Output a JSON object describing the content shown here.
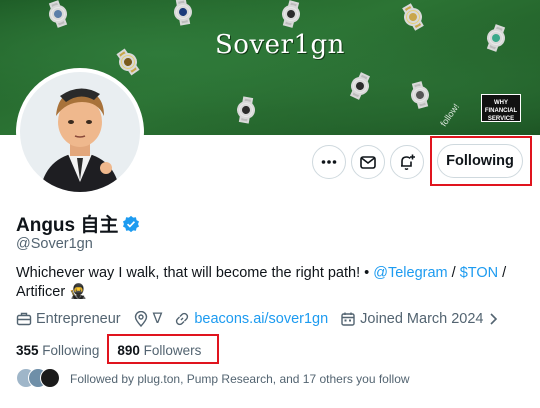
{
  "banner": {
    "title": "Sover1gn",
    "brand_lines": [
      "WHY",
      "FINANCIAL",
      "SERVICE"
    ],
    "scribble": "follow!"
  },
  "actions": {
    "more_icon": "more-icon",
    "message_icon": "mail-icon",
    "notify_icon": "bell-plus-icon",
    "following_label": "Following"
  },
  "profile": {
    "name": "Angus 自主",
    "handle": "@Sover1gn",
    "bio_text": "Whichever way I walk, that will become the right path! • ",
    "bio_link_telegram": "@Telegram",
    "bio_sep": " / ",
    "bio_link_ton": "$TON",
    "bio_tail": " /",
    "bio_line2": "Artificer 🥷"
  },
  "meta": {
    "category": "Entrepreneur",
    "location": "∇",
    "website": "beacons.ai/sover1gn",
    "joined": "Joined March 2024"
  },
  "stats": {
    "following_count": "355",
    "following_label": "Following",
    "followers_count": "890",
    "followers_label": "Followers"
  },
  "followed_by": "Followed by plug.ton, Pump Research, and 17 others you follow",
  "colors": {
    "link": "#1d9bf0",
    "highlight": "#e0141e",
    "banner": "#2c7434"
  }
}
